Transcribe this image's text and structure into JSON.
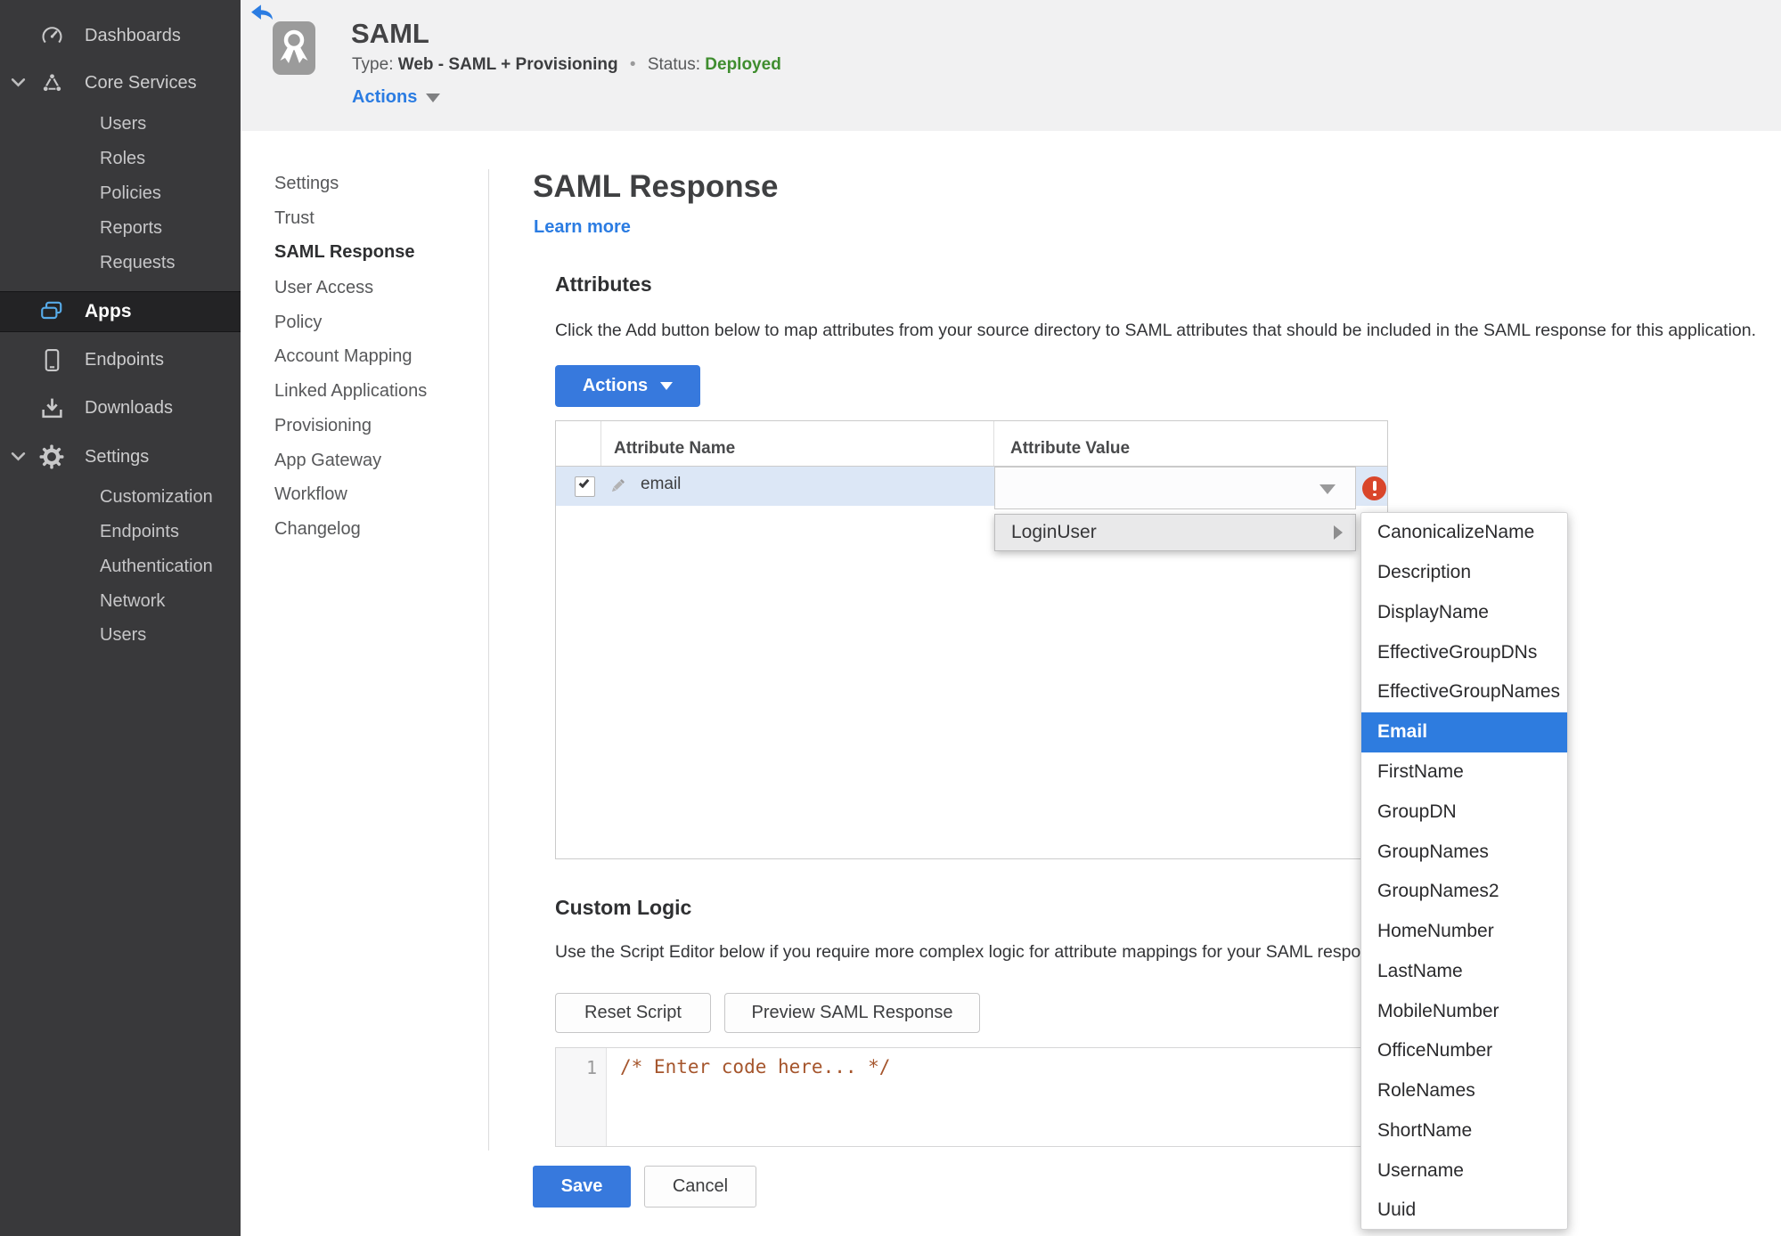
{
  "colors": {
    "accent_blue": "#3779dd",
    "link_blue": "#2b7ce2",
    "status_green": "#3f8d2f",
    "error_red": "#d9462b",
    "sidebar_bg": "#39393b",
    "row_highlight": "#dce7f6"
  },
  "sidebar": {
    "items": [
      {
        "label": "Dashboards"
      },
      {
        "label": "Core Services"
      },
      {
        "label": "Users"
      },
      {
        "label": "Roles"
      },
      {
        "label": "Policies"
      },
      {
        "label": "Reports"
      },
      {
        "label": "Requests"
      },
      {
        "label": "Apps"
      },
      {
        "label": "Endpoints"
      },
      {
        "label": "Downloads"
      },
      {
        "label": "Settings"
      },
      {
        "label": "Customization"
      },
      {
        "label": "Endpoints"
      },
      {
        "label": "Authentication"
      },
      {
        "label": "Network"
      },
      {
        "label": "Users"
      }
    ]
  },
  "app_header": {
    "title": "SAML",
    "type_label": "Type:",
    "type_value": "Web - SAML + Provisioning",
    "separator": "•",
    "status_label": "Status:",
    "status_value": "Deployed",
    "actions_label": "Actions"
  },
  "subnav": {
    "items": [
      {
        "label": "Settings"
      },
      {
        "label": "Trust"
      },
      {
        "label": "SAML Response"
      },
      {
        "label": "User Access"
      },
      {
        "label": "Policy"
      },
      {
        "label": "Account Mapping"
      },
      {
        "label": "Linked Applications"
      },
      {
        "label": "Provisioning"
      },
      {
        "label": "App Gateway"
      },
      {
        "label": "Workflow"
      },
      {
        "label": "Changelog"
      }
    ]
  },
  "main": {
    "title": "SAML Response",
    "learn_more": "Learn more",
    "attributes": {
      "heading": "Attributes",
      "description": "Click the Add button below to map attributes from your source directory to SAML attributes that should be included in the SAML response for this application.",
      "actions_button": "Actions",
      "table": {
        "col_name": "Attribute Name",
        "col_value": "Attribute Value",
        "row_name": "email"
      }
    },
    "value_menu": {
      "parent": "LoginUser",
      "selected": "Email",
      "options": [
        "CanonicalizeName",
        "Description",
        "DisplayName",
        "EffectiveGroupDNs",
        "EffectiveGroupNames",
        "Email",
        "FirstName",
        "GroupDN",
        "GroupNames",
        "GroupNames2",
        "HomeNumber",
        "LastName",
        "MobileNumber",
        "OfficeNumber",
        "RoleNames",
        "ShortName",
        "Username",
        "Uuid"
      ]
    },
    "custom_logic": {
      "heading": "Custom Logic",
      "description": "Use the Script Editor below if you require more complex logic for attribute mappings for your SAML response.",
      "reset_button": "Reset Script",
      "preview_button": "Preview SAML Response",
      "line_number": "1",
      "code": "/* Enter code here... */"
    },
    "footer": {
      "save": "Save",
      "cancel": "Cancel"
    }
  }
}
